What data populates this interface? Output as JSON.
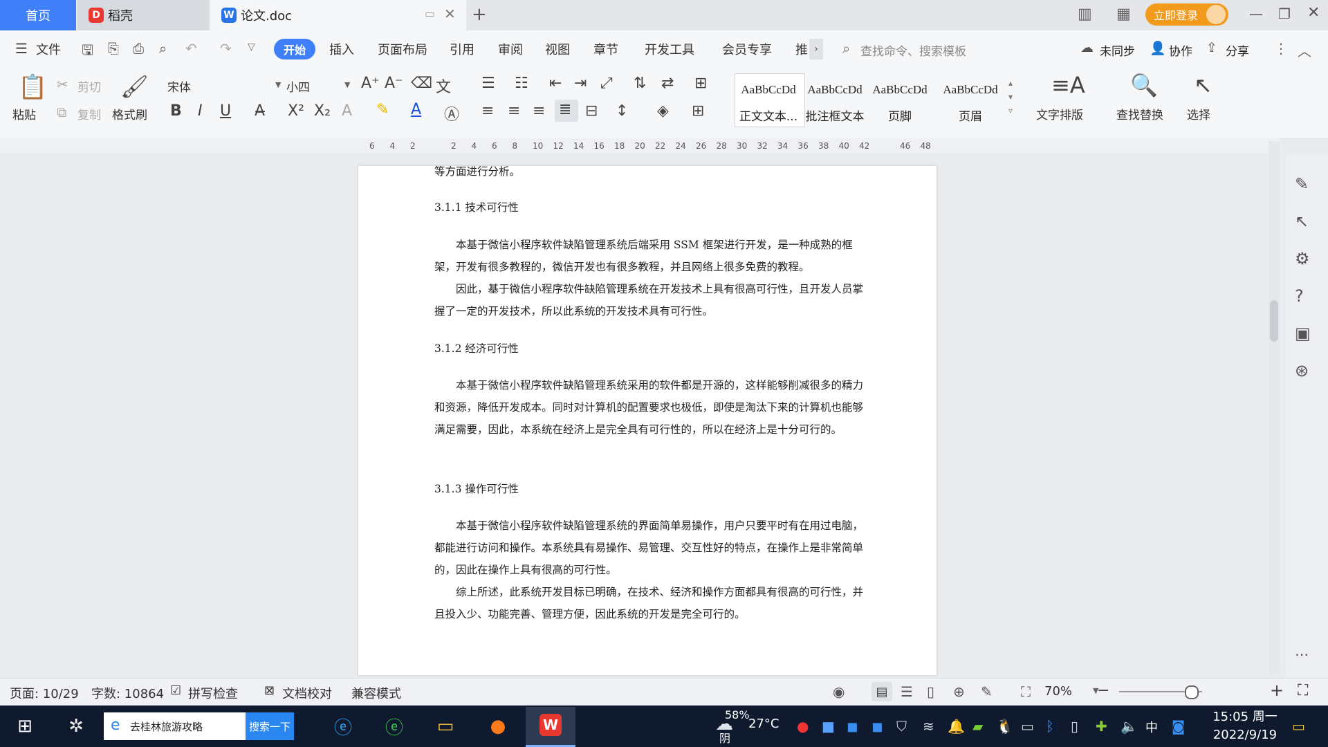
{
  "tabs": {
    "home": "首页",
    "docer": "稻壳",
    "doc": "论文.doc",
    "new_tab": "+"
  },
  "window": {
    "login": "立即登录"
  },
  "menu": {
    "file": "文件",
    "items": [
      "开始",
      "插入",
      "页面布局",
      "引用",
      "审阅",
      "视图",
      "章节",
      "开发工具",
      "会员专享",
      "推"
    ],
    "search_placeholder": "查找命令、搜索模板",
    "sync": "未同步",
    "collab": "协作",
    "share": "分享"
  },
  "ribbon": {
    "paste": "粘贴",
    "cut": "剪切",
    "copy": "复制",
    "format_painter": "格式刷",
    "font_name": "宋体",
    "font_size": "小四",
    "styles": [
      {
        "preview": "AaBbCcDd",
        "label": "正文文本..."
      },
      {
        "preview": "AaBbCcDd",
        "label": "批注框文本"
      },
      {
        "preview": "AaBbCcDd",
        "label": "页脚"
      },
      {
        "preview": "AaBbCcDd",
        "label": "页眉"
      }
    ],
    "text_layout": "文字排版",
    "find_replace": "查找替换",
    "select": "选择"
  },
  "ruler": {
    "ticks": [
      "6",
      "4",
      "2",
      "",
      "2",
      "4",
      "6",
      "8",
      "10",
      "12",
      "14",
      "16",
      "18",
      "20",
      "22",
      "24",
      "26",
      "28",
      "30",
      "32",
      "34",
      "36",
      "38",
      "40",
      "42",
      "",
      "46",
      "48"
    ]
  },
  "document": {
    "line_top": "等方面进行分析。",
    "h1": "3.1.1 技术可行性",
    "p1": "本基于微信小程序软件缺陷管理系统后端采用 SSM 框架进行开发，是一种成熟的框架，开发有很多教程的，微信开发也有很多教程，并且网络上很多免费的教程。",
    "p2": "因此，基于微信小程序软件缺陷管理系统在开发技术上具有很高可行性，且开发人员掌握了一定的开发技术，所以此系统的开发技术具有可行性。",
    "h2": "3.1.2 经济可行性",
    "p3": "本基于微信小程序软件缺陷管理系统采用的软件都是开源的，这样能够削减很多的精力和资源，降低开发成本。同时对计算机的配置要求也极低，即使是淘汰下来的计算机也能够满足需要，因此，本系统在经济上是完全具有可行性的，所以在经济上是十分可行的。",
    "h3": "3.1.3 操作可行性",
    "p4": "本基于微信小程序软件缺陷管理系统的界面简单易操作，用户只要平时有在用过电脑，都能进行访问和操作。本系统具有易操作、易管理、交互性好的特点，在操作上是非常简单的，因此在操作上具有很高的可行性。",
    "p5": "综上所述，此系统开发目标已明确，在技术、经济和操作方面都具有很高的可行性，并且投入少、功能完善、管理方便，因此系统的开发是完全可行的。"
  },
  "status": {
    "page": "页面: 10/29",
    "words": "字数: 10864",
    "spell": "拼写检查",
    "proof": "文档校对",
    "compat": "兼容模式",
    "zoom": "70%"
  },
  "taskbar": {
    "search_text": "去桂林旅游攻略",
    "search_button": "搜索一下",
    "weather": "58%",
    "temp": "27°C",
    "weather_label": "阴",
    "ime": "中",
    "time": "15:05 周一",
    "date": "2022/9/19"
  }
}
